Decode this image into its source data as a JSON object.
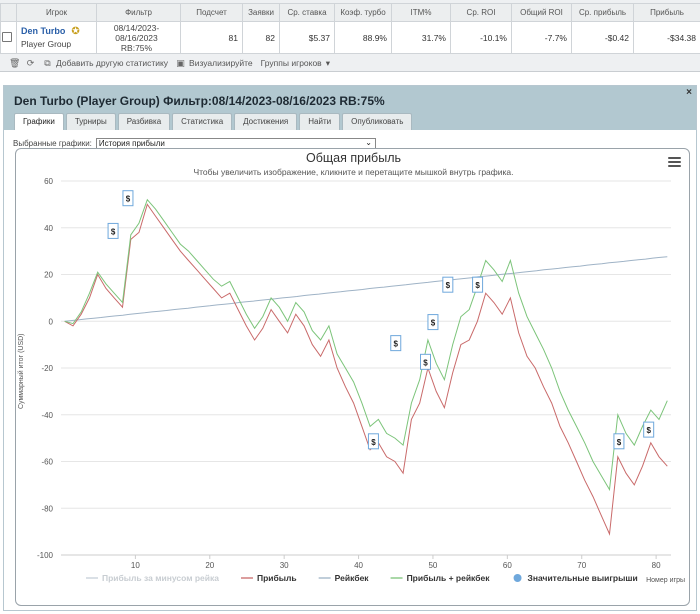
{
  "stats_table": {
    "headers": [
      "Игрок",
      "Фильтр",
      "Подсчет",
      "Заявки",
      "Ср. ставка",
      "Коэф. турбо",
      "ITM%",
      "Ср. ROI",
      "Общий ROI",
      "Ср. прибыль",
      "Прибыль"
    ],
    "row": {
      "player_name": "Den Turbo",
      "player_group": "Player Group",
      "filter_line1": "08/14/2023-",
      "filter_line2": "08/16/2023",
      "filter_line3": "RB:75%",
      "count": "81",
      "entries": "82",
      "avg_stake": "$5.37",
      "turbo_coef": "88.9%",
      "itm": "31.7%",
      "avg_roi": "-10.1%",
      "total_roi": "-7.7%",
      "avg_profit": "-$0.42",
      "profit": "-$34.38"
    }
  },
  "toolbar": {
    "add_stats": "Добавить другую статистику",
    "visualize": "Визуализируйте",
    "player_groups": "Группы игроков"
  },
  "panel": {
    "title": "Den Turbo (Player Group) Фильтр:08/14/2023-08/16/2023 RB:75%",
    "close": "×",
    "tabs": [
      "Графики",
      "Турниры",
      "Разбивка",
      "Статистика",
      "Достижения",
      "Найти",
      "Опубликовать"
    ],
    "selected_label": "Выбранные графики:",
    "selected_value": "История прибыли"
  },
  "chart_data": {
    "type": "line",
    "title": "Общая прибыль",
    "subtitle": "Чтобы увеличить изображение, кликните и перетащите мышкой внутрь графика.",
    "ylabel": "Суммарный итог (USD)",
    "xlabel": "Номер игры",
    "ylim": [
      -100,
      60
    ],
    "xlim": [
      0,
      82
    ],
    "yticks": [
      -100,
      -80,
      -60,
      -40,
      -20,
      0,
      20,
      40,
      60
    ],
    "xticks": [
      10,
      20,
      30,
      40,
      50,
      60,
      70,
      80
    ],
    "grid": "horizontal",
    "legend_position": "bottom",
    "legend": [
      {
        "name": "Прибыль за минусом рейка",
        "color": "#c5d0d8",
        "dimmed": true
      },
      {
        "name": "Прибыль",
        "color": "#c96a6a"
      },
      {
        "name": "Рейкбек",
        "color": "#9fb3c6"
      },
      {
        "name": "Прибыль + рейкбек",
        "color": "#7cc47a"
      },
      {
        "name": "Значительные выигрыши",
        "color": "#6fa8dc",
        "marker": "circle"
      }
    ],
    "colors": {
      "profit": "#c96a6a",
      "rakeback": "#9fb3c6",
      "profit_plus": "#7cc47a",
      "axis": "#cccccc"
    },
    "series": [
      {
        "name": "Прибыль",
        "key": "profit",
        "values": [
          0,
          -2,
          3,
          10,
          20,
          14,
          10,
          6,
          35,
          38,
          50,
          45,
          40,
          35,
          30,
          26,
          22,
          18,
          14,
          10,
          12,
          5,
          -2,
          -8,
          -3,
          5,
          0,
          -5,
          3,
          -2,
          -10,
          -15,
          -8,
          -20,
          -28,
          -35,
          -45,
          -55,
          -52,
          -58,
          -60,
          -65,
          -42,
          -35,
          -20,
          -30,
          -37,
          -22,
          -10,
          -8,
          0,
          12,
          8,
          3,
          10,
          -5,
          -15,
          -20,
          -28,
          -35,
          -45,
          -52,
          -60,
          -68,
          -75,
          -83,
          -91,
          -58,
          -65,
          -70,
          -62,
          -52,
          -58,
          -62
        ]
      },
      {
        "name": "Рейкбек",
        "key": "rakeback",
        "values": [
          0,
          0.3,
          0.6,
          1,
          1.3,
          1.6,
          2,
          2.3,
          2.6,
          3,
          3.3,
          3.6,
          4,
          4.3,
          4.6,
          5,
          5.3,
          5.6,
          6,
          6.3,
          6.6,
          7,
          7.3,
          7.6,
          8,
          8.3,
          8.6,
          9,
          9.3,
          9.6,
          10,
          10.3,
          10.6,
          11,
          11.3,
          11.6,
          12,
          12.3,
          12.6,
          13,
          13.3,
          13.6,
          14,
          14.3,
          14.6,
          15,
          15.3,
          15.6,
          16,
          16.3,
          16.6,
          17,
          17.3,
          17.6,
          18,
          18.3,
          18.6,
          19,
          19.3,
          19.6,
          20,
          20.3,
          20.6,
          21,
          21.3,
          21.6,
          22,
          22.3,
          22.6,
          23,
          23.3,
          23.6,
          24,
          24.3,
          24.6,
          25,
          25.3,
          25.6,
          26,
          26.3,
          26.6,
          27,
          27.3,
          27.6
        ]
      },
      {
        "name": "Прибыль + рейкбек",
        "key": "profit_plus",
        "values": [
          0,
          -1,
          4,
          12,
          21,
          16,
          12,
          8,
          37,
          42,
          52,
          48,
          43,
          38,
          33,
          30,
          26,
          22,
          18,
          15,
          17,
          10,
          3,
          -3,
          2,
          10,
          6,
          0,
          8,
          4,
          -4,
          -8,
          -2,
          -14,
          -20,
          -26,
          -35,
          -45,
          -42,
          -48,
          -50,
          -53,
          -35,
          -25,
          -8,
          -18,
          -25,
          -10,
          2,
          5,
          15,
          26,
          22,
          17,
          26,
          12,
          2,
          -5,
          -12,
          -20,
          -30,
          -38,
          -45,
          -52,
          -60,
          -66,
          -72,
          -40,
          -48,
          -53,
          -45,
          -38,
          -42,
          -34
        ]
      }
    ],
    "big_wins": [
      {
        "x": 7,
        "y": 38,
        "label": "$"
      },
      {
        "x": 9,
        "y": 52,
        "label": "$"
      },
      {
        "x": 42,
        "y": -52,
        "label": "$"
      },
      {
        "x": 45,
        "y": -10,
        "label": "$"
      },
      {
        "x": 49,
        "y": -18,
        "label": "$"
      },
      {
        "x": 50,
        "y": -1,
        "label": "$"
      },
      {
        "x": 52,
        "y": 15,
        "label": "$"
      },
      {
        "x": 56,
        "y": 15,
        "label": "$"
      },
      {
        "x": 75,
        "y": -52,
        "label": "$"
      },
      {
        "x": 79,
        "y": -47,
        "label": "$"
      }
    ]
  }
}
